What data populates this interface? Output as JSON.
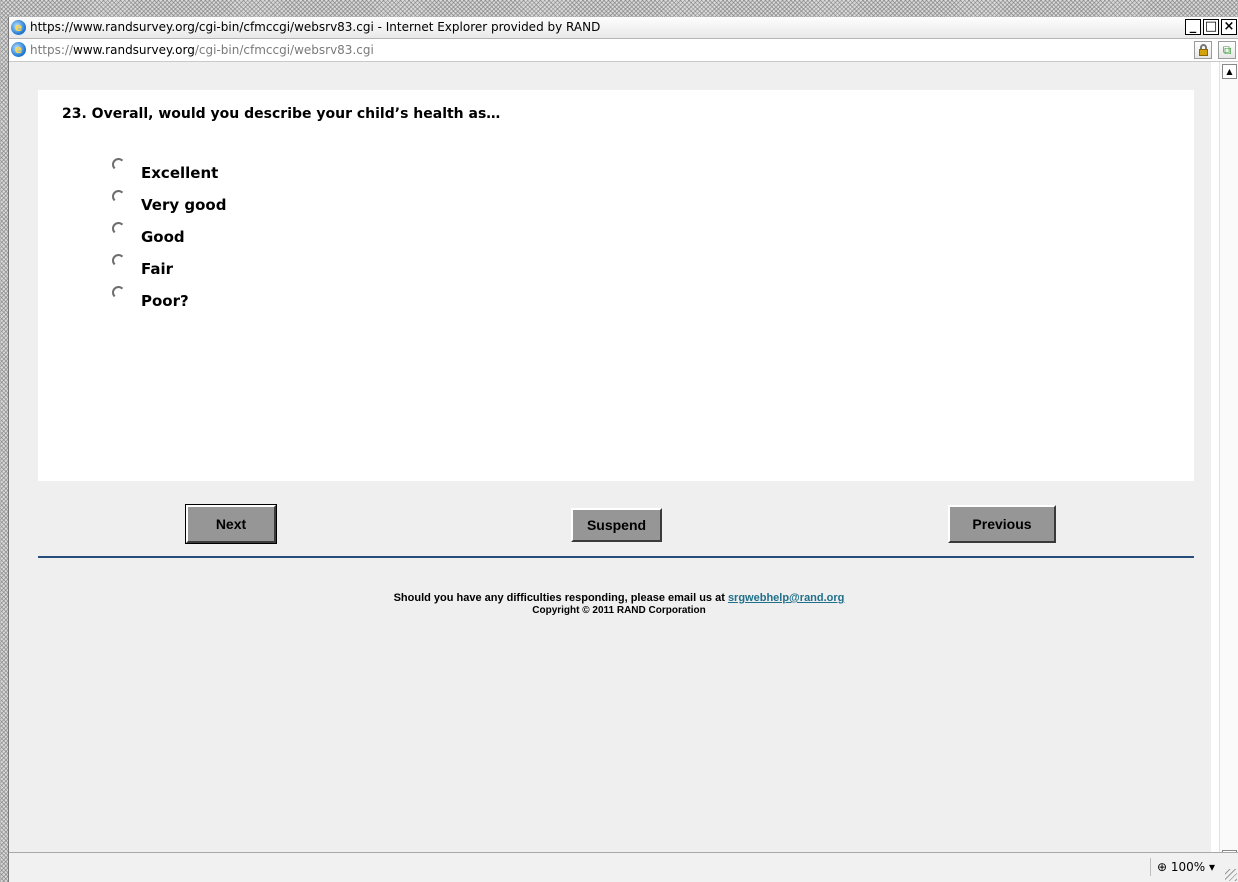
{
  "window": {
    "title": "https://www.randsurvey.org/cgi-bin/cfmccgi/websrv83.cgi - Internet Explorer provided by RAND",
    "minimize": "_",
    "maximize": "□",
    "close": "×"
  },
  "address": {
    "scheme": "https://",
    "host": "www.randsurvey.org",
    "path": "/cgi-bin/cfmccgi/websrv83.cgi"
  },
  "survey": {
    "question": "23. Overall, would you describe your child’s health as…",
    "options": [
      "Excellent",
      "Very good",
      "Good",
      "Fair",
      "Poor?"
    ]
  },
  "buttons": {
    "next": "Next",
    "suspend": "Suspend",
    "previous": "Previous"
  },
  "footer": {
    "help_text": "Should you have any difficulties responding, please email us at ",
    "email": "srgwebhelp@rand.org",
    "copyright": "Copyright © 2011 RAND Corporation"
  },
  "status": {
    "zoom": "100%"
  },
  "icons": {
    "browser": "internet-explorer-icon",
    "security": "lock-icon",
    "compat": "compatibility-view-icon",
    "zoom": "zoom-icon"
  }
}
